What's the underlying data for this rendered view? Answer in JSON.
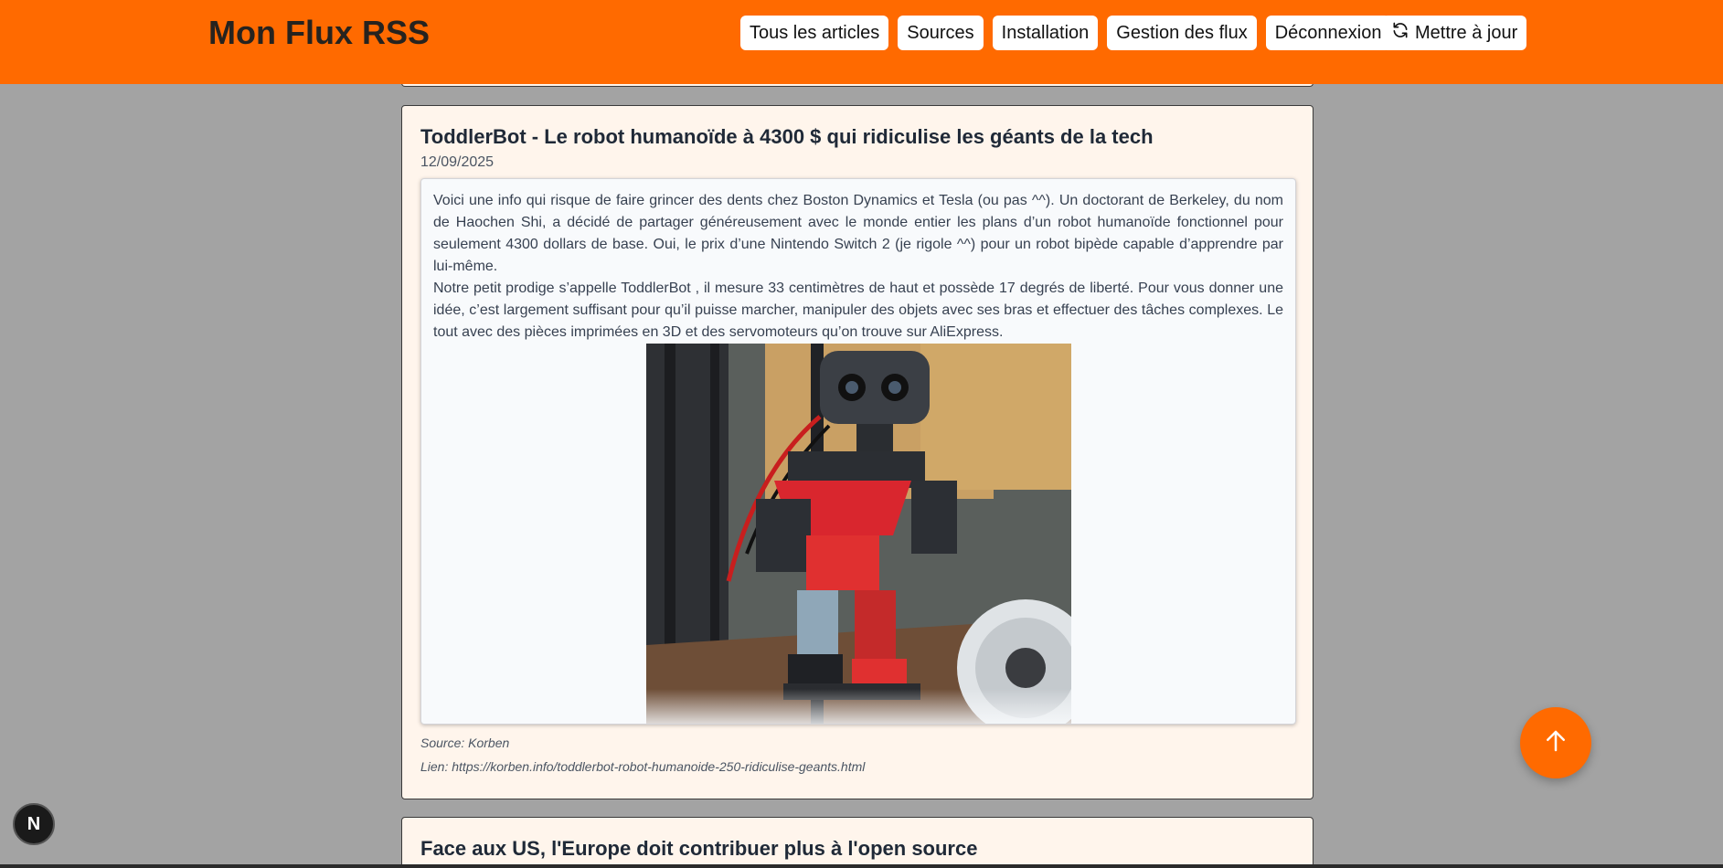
{
  "header": {
    "brand": "Mon Flux RSS",
    "nav": [
      "Tous les articles",
      "Sources",
      "Installation",
      "Gestion des flux",
      "Déconnexion"
    ],
    "refresh_label": "Mettre à jour",
    "bg_color": "#ff6a00"
  },
  "article": {
    "title": "ToddlerBot - Le robot humanoïde à 4300 $ qui ridiculise les géants de la tech",
    "date": "12/09/2025",
    "paragraphs": [
      "Voici une info qui risque de faire grincer des dents chez Boston Dynamics et Tesla (ou pas ^^). Un doctorant de Berkeley, du nom de Haochen Shi, a décidé de partager généreusement avec le monde entier les plans d’un robot humanoïde fonctionnel pour seulement 4300 dollars de base. Oui, le prix d’une Nintendo Switch 2 (je rigole ^^) pour un robot bipède capable d’apprendre par lui-même.",
      "Notre petit prodige s’appelle ToddlerBot , il mesure 33 centimètres de haut et possède 17 degrés de liberté. Pour vous donner une idée, c’est largement suffisant pour qu’il puisse marcher, manipuler des objets avec ses bras et effectuer des tâches complexes. Le tout avec des pièces imprimées en 3D et des servomoteurs qu’on trouve sur AliExpress."
    ],
    "source": "Source: Korben",
    "link": "Lien: https://korben.info/toddlerbot-robot-humanoide-250-ridiculise-geants.html"
  },
  "next_article": {
    "title": "Face aux US, l'Europe doit contribuer plus à l'open source"
  },
  "badge_letter": "N",
  "icons": {
    "refresh": "refresh-icon",
    "scroll_top": "arrow-up-icon"
  }
}
